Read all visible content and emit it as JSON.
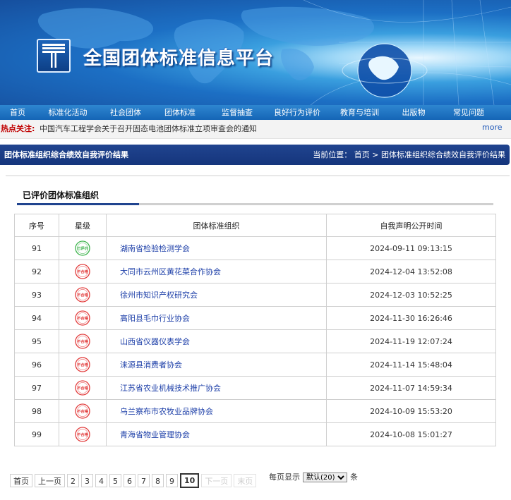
{
  "site": {
    "title": "全国团体标准信息平台"
  },
  "nav": {
    "items": [
      "首页",
      "标准化活动",
      "社会团体",
      "团体标准",
      "监督抽查",
      "良好行为评价",
      "教育与培训",
      "出版物",
      "常见问题"
    ]
  },
  "hot": {
    "label": "热点关注:",
    "text": "中国汽车工程学会关于召开固态电池团体标准立项审查会的通知",
    "more": "more"
  },
  "section": {
    "title": "团体标准组织综合绩效自我评价结果",
    "crumb_prefix": "当前位置：",
    "crumb_home": "首页",
    "crumb_sep": ">",
    "crumb_current": "团体标准组织综合绩效自我评价结果"
  },
  "subsection": {
    "title": "已评价团体标准组织"
  },
  "table": {
    "headers": {
      "seq": "序号",
      "rating": "星级",
      "org": "团体标准组织",
      "time": "自我声明公开时间"
    },
    "rows": [
      {
        "seq": "91",
        "rating": "已评价",
        "rating_color": "#3bb34a",
        "org": "湖南省检验检测学会",
        "time": "2024-09-11 09:13:15"
      },
      {
        "seq": "92",
        "rating": "不合格",
        "rating_color": "#e23a3a",
        "org": "大同市云州区黄花菜合作协会",
        "time": "2024-12-04 13:52:08"
      },
      {
        "seq": "93",
        "rating": "不合格",
        "rating_color": "#e23a3a",
        "org": "徐州市知识产权研究会",
        "time": "2024-12-03 10:52:25"
      },
      {
        "seq": "94",
        "rating": "不合格",
        "rating_color": "#e23a3a",
        "org": "高阳县毛巾行业协会",
        "time": "2024-11-30 16:26:46"
      },
      {
        "seq": "95",
        "rating": "不合格",
        "rating_color": "#e23a3a",
        "org": "山西省仪器仪表学会",
        "time": "2024-11-19 12:07:24"
      },
      {
        "seq": "96",
        "rating": "不合格",
        "rating_color": "#e23a3a",
        "org": "涞源县消费者协会",
        "time": "2024-11-14 15:48:04"
      },
      {
        "seq": "97",
        "rating": "不合格",
        "rating_color": "#e23a3a",
        "org": "江苏省农业机械技术推广协会",
        "time": "2024-11-07 14:59:34"
      },
      {
        "seq": "98",
        "rating": "不合格",
        "rating_color": "#e23a3a",
        "org": "乌兰察布市农牧业品牌协会",
        "time": "2024-10-09 15:53:20"
      },
      {
        "seq": "99",
        "rating": "不合格",
        "rating_color": "#e23a3a",
        "org": "青海省物业管理协会",
        "time": "2024-10-08 15:01:27"
      }
    ]
  },
  "pager": {
    "first": "首页",
    "prev": "上一页",
    "next": "下一页",
    "last": "末页",
    "pages": [
      "2",
      "3",
      "4",
      "5",
      "6",
      "7",
      "8",
      "9",
      "10"
    ],
    "current": "10",
    "per_page_label": "每页显示",
    "per_page_value": "默认(20)",
    "per_page_unit": "条"
  },
  "colors": {
    "nav_bg": "#1f75c4",
    "section_bg": "#1c3f89",
    "link": "#1d3fa8",
    "hot_label": "#c00000"
  }
}
